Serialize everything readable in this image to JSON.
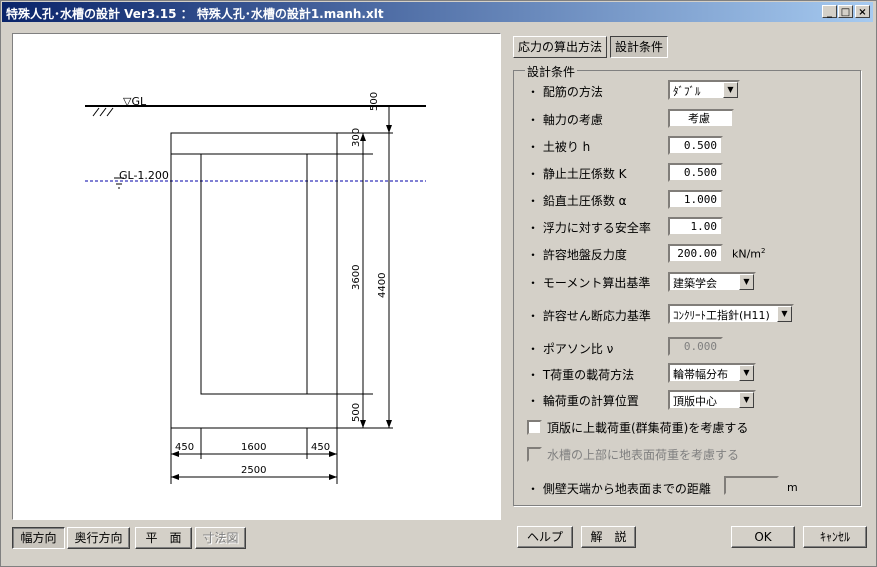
{
  "window": {
    "title": "特殊人孔･水槽の設計 Ver3.15 ： 特殊人孔･水槽の設計1.manh.xlt"
  },
  "title_buttons": {
    "minimize": "_",
    "maximize": "□",
    "close": "×"
  },
  "tabs": [
    "応力の算出方法",
    "設計条件"
  ],
  "groupbox_title": "設計条件",
  "bullet": "・",
  "fields": {
    "rebar_method": {
      "label": "配筋の方法",
      "value": "ﾀﾞﾌﾞﾙ"
    },
    "axial_force": {
      "label": "軸力の考慮",
      "value": "考慮"
    },
    "cover_h": {
      "label": "土被り h",
      "value": "0.500"
    },
    "rest_pressure": {
      "label": "静止土圧係数 K",
      "value": "0.500"
    },
    "vert_pressure": {
      "label": "鉛直土圧係数 α",
      "value": "1.000"
    },
    "buoyancy_sf": {
      "label": "浮力に対する安全率",
      "value": "1.00"
    },
    "bearing": {
      "label": "許容地盤反力度",
      "value": "200.00",
      "unit": "kN/m",
      "sup": "2"
    },
    "moment_std": {
      "label": "モーメント算出基準",
      "value": "建築学会"
    },
    "shear_std": {
      "label": "許容せん断応力基準",
      "value": "ｺﾝｸﾘｰﾄ工指針(H11)"
    },
    "poisson": {
      "label": "ポアソン比 ν",
      "value": "0.000"
    },
    "t_load": {
      "label": "T荷重の載荷方法",
      "value": "輪帯幅分布"
    },
    "wheel_pos": {
      "label": "輪荷重の計算位置",
      "value": "頂版中心"
    },
    "crowd_load": {
      "label": "頂版に上載荷重(群集荷重)を考慮する",
      "checked": false
    },
    "surface_load": {
      "label": "水槽の上部に地表面荷重を考慮する",
      "checked": false
    },
    "wall_distance": {
      "label": "側壁天端から地表面までの距離",
      "value": "",
      "unit": "m"
    }
  },
  "view_buttons": [
    "幅方向",
    "奥行方向",
    "平　面",
    "寸法図"
  ],
  "footer_buttons": {
    "help": "ヘルプ",
    "explain": "解　説",
    "ok": "OK",
    "cancel": "ｷｬﾝｾﾙ"
  },
  "drawing": {
    "ground_label": "▽GL",
    "water_label": "GL-1.200",
    "dims_right": [
      "500",
      "300",
      "3600",
      "4400",
      "500"
    ],
    "dims_bottom": [
      "450",
      "1600",
      "450",
      "2500"
    ]
  }
}
